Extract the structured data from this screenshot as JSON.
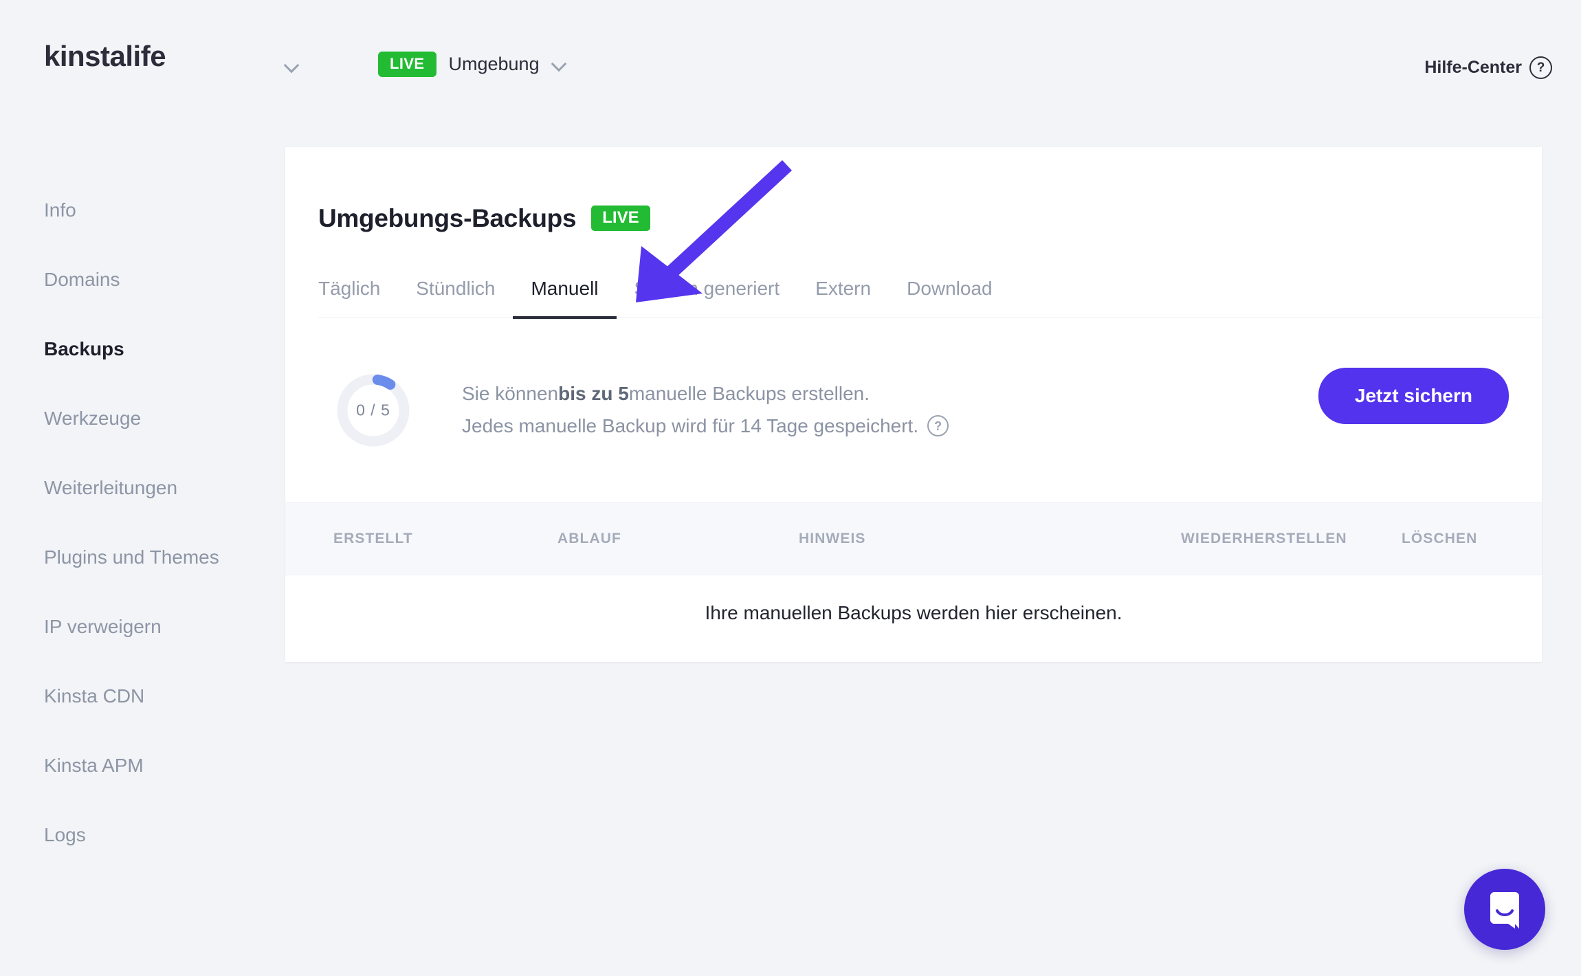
{
  "header": {
    "brand": "kinstalife",
    "brand_chevron_icon": "chevron-down-icon",
    "env_badge": "LIVE",
    "env_label": "Umgebung",
    "env_chevron_icon": "chevron-down-icon",
    "help_center": "Hilfe-Center",
    "help_icon_glyph": "?"
  },
  "sidebar": {
    "items": [
      {
        "label": "Info",
        "active": false
      },
      {
        "label": "Domains",
        "active": false
      },
      {
        "label": "Backups",
        "active": true
      },
      {
        "label": "Werkzeuge",
        "active": false
      },
      {
        "label": "Weiterleitungen",
        "active": false
      },
      {
        "label": "Plugins und Themes",
        "active": false
      },
      {
        "label": "IP verweigern",
        "active": false
      },
      {
        "label": "Kinsta CDN",
        "active": false
      },
      {
        "label": "Kinsta APM",
        "active": false
      },
      {
        "label": "Logs",
        "active": false
      }
    ]
  },
  "card": {
    "title": "Umgebungs-Backups",
    "badge": "LIVE",
    "tabs": [
      {
        "label": "Täglich",
        "active": false
      },
      {
        "label": "Stündlich",
        "active": false
      },
      {
        "label": "Manuell",
        "active": true
      },
      {
        "label": "System generiert",
        "active": false
      },
      {
        "label": "Extern",
        "active": false
      },
      {
        "label": "Download",
        "active": false
      }
    ],
    "quota": {
      "ring_label": "0 / 5",
      "used": 0,
      "total": 5,
      "percent": 7,
      "track_color": "#eef0f5",
      "arc_color": "#6a8ceb"
    },
    "info_line_1_a": "Sie können ",
    "info_line_1_b": "bis zu 5",
    "info_line_1_c": " manuelle Backups erstellen.",
    "info_line_2": "Jedes manuelle Backup wird für 14 Tage gespeichert.",
    "info_help_icon_glyph": "?",
    "primary_button": "Jetzt sichern",
    "primary_button_color": "#5333ed",
    "table": {
      "columns": [
        "ERSTELLT",
        "ABLAUF",
        "HINWEIS",
        "WIEDERHERSTELLEN",
        "LÖSCHEN"
      ],
      "rows": [],
      "empty_message": "Ihre manuellen Backups werden hier erscheinen."
    }
  },
  "annotation": {
    "arrow_color": "#5635ef",
    "points_to": "Manuell"
  },
  "intercom": {
    "icon": "chat-bubble-icon",
    "color": "#4628d6"
  }
}
